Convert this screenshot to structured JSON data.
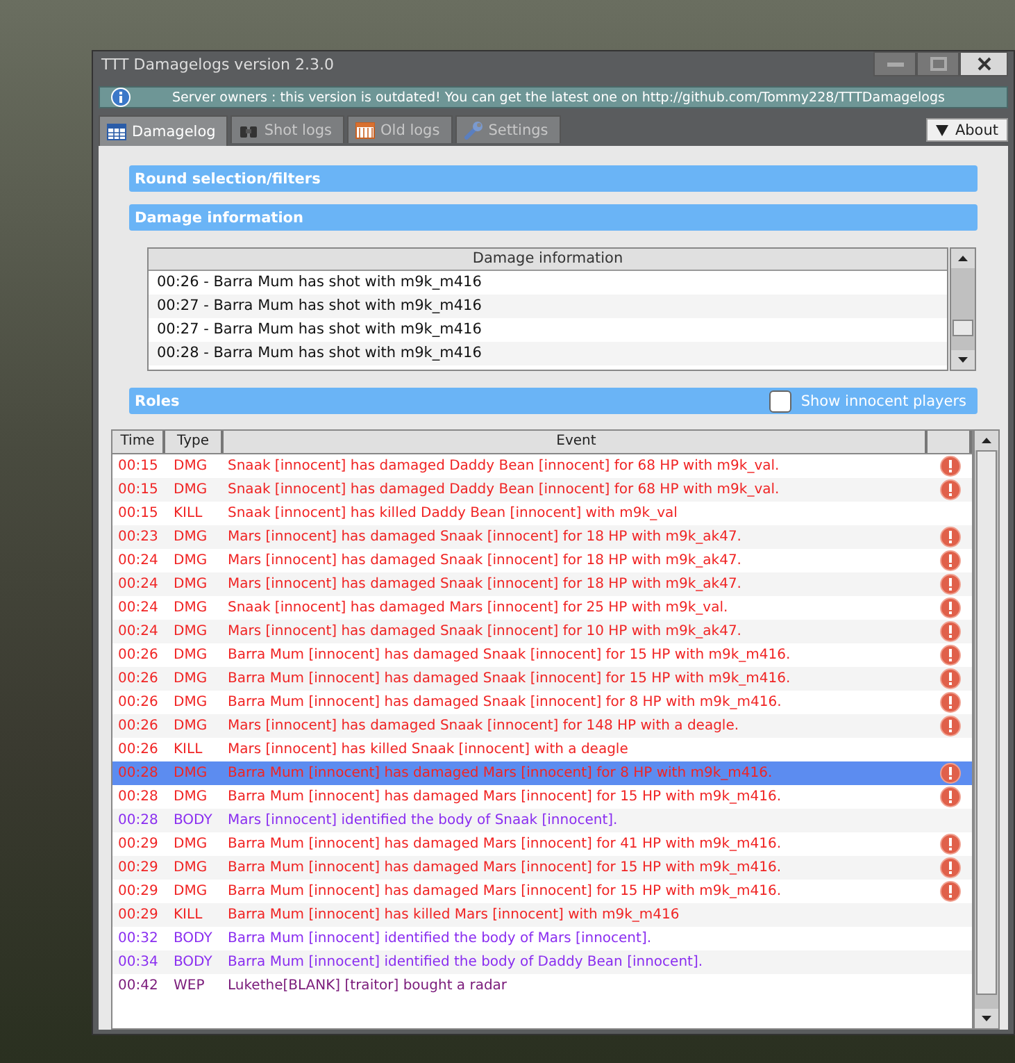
{
  "window": {
    "title": "TTT Damagelogs version 2.3.0"
  },
  "notice": {
    "text": "Server owners : this version is outdated! You can get the latest one on http://github.com/Tommy228/TTTDamagelogs"
  },
  "tabs": [
    {
      "label": "Damagelog",
      "selected": true
    },
    {
      "label": "Shot logs",
      "selected": false
    },
    {
      "label": "Old logs",
      "selected": false
    },
    {
      "label": "Settings",
      "selected": false
    }
  ],
  "about_button": {
    "label": "About"
  },
  "sections": {
    "round_selection": {
      "title": "Round selection/filters"
    },
    "damage_information": {
      "title": "Damage information"
    },
    "roles": {
      "title": "Roles"
    }
  },
  "damage_list": {
    "column": "Damage information",
    "rows": [
      "00:26 - Barra Mum has shot with m9k_m416",
      "00:27 - Barra Mum has shot with m9k_m416",
      "00:27 - Barra Mum has shot with m9k_m416",
      "00:28 - Barra Mum has shot with m9k_m416"
    ]
  },
  "show_innocent": {
    "label": "Show innocent players",
    "checked": false
  },
  "log_table": {
    "columns": [
      "Time",
      "Type",
      "Event"
    ],
    "rows": [
      {
        "time": "00:15",
        "type": "DMG",
        "kind": "dmg",
        "event": "Snaak [innocent] has damaged Daddy Bean [innocent] for 68 HP with m9k_val.",
        "alert": true,
        "selected": false
      },
      {
        "time": "00:15",
        "type": "DMG",
        "kind": "dmg",
        "event": "Snaak [innocent] has damaged Daddy Bean [innocent] for 68 HP with m9k_val.",
        "alert": true,
        "selected": false
      },
      {
        "time": "00:15",
        "type": "KILL",
        "kind": "kill",
        "event": "Snaak [innocent] has killed Daddy Bean [innocent] with m9k_val",
        "alert": false,
        "selected": false
      },
      {
        "time": "00:23",
        "type": "DMG",
        "kind": "dmg",
        "event": "Mars [innocent] has damaged Snaak [innocent] for 18 HP with m9k_ak47.",
        "alert": true,
        "selected": false
      },
      {
        "time": "00:24",
        "type": "DMG",
        "kind": "dmg",
        "event": "Mars [innocent] has damaged Snaak [innocent] for 18 HP with m9k_ak47.",
        "alert": true,
        "selected": false
      },
      {
        "time": "00:24",
        "type": "DMG",
        "kind": "dmg",
        "event": "Mars [innocent] has damaged Snaak [innocent] for 18 HP with m9k_ak47.",
        "alert": true,
        "selected": false
      },
      {
        "time": "00:24",
        "type": "DMG",
        "kind": "dmg",
        "event": "Snaak [innocent] has damaged Mars [innocent] for 25 HP with m9k_val.",
        "alert": true,
        "selected": false
      },
      {
        "time": "00:24",
        "type": "DMG",
        "kind": "dmg",
        "event": "Mars [innocent] has damaged Snaak [innocent] for 10 HP with m9k_ak47.",
        "alert": true,
        "selected": false
      },
      {
        "time": "00:26",
        "type": "DMG",
        "kind": "dmg",
        "event": "Barra Mum [innocent] has damaged Snaak [innocent] for 15 HP with m9k_m416.",
        "alert": true,
        "selected": false
      },
      {
        "time": "00:26",
        "type": "DMG",
        "kind": "dmg",
        "event": "Barra Mum [innocent] has damaged Snaak [innocent] for 15 HP with m9k_m416.",
        "alert": true,
        "selected": false
      },
      {
        "time": "00:26",
        "type": "DMG",
        "kind": "dmg",
        "event": "Barra Mum [innocent] has damaged Snaak [innocent] for 8 HP with m9k_m416.",
        "alert": true,
        "selected": false
      },
      {
        "time": "00:26",
        "type": "DMG",
        "kind": "dmg",
        "event": "Mars [innocent] has damaged Snaak [innocent] for 148 HP with a deagle.",
        "alert": true,
        "selected": false
      },
      {
        "time": "00:26",
        "type": "KILL",
        "kind": "kill",
        "event": "Mars [innocent] has killed Snaak [innocent] with a deagle",
        "alert": false,
        "selected": false
      },
      {
        "time": "00:28",
        "type": "DMG",
        "kind": "dmg",
        "event": "Barra Mum [innocent] has damaged Mars [innocent] for 8 HP with m9k_m416.",
        "alert": true,
        "selected": true
      },
      {
        "time": "00:28",
        "type": "DMG",
        "kind": "dmg",
        "event": "Barra Mum [innocent] has damaged Mars [innocent] for 15 HP with m9k_m416.",
        "alert": true,
        "selected": false
      },
      {
        "time": "00:28",
        "type": "BODY",
        "kind": "body",
        "event": "Mars [innocent] identified the body of Snaak [innocent].",
        "alert": false,
        "selected": false
      },
      {
        "time": "00:29",
        "type": "DMG",
        "kind": "dmg",
        "event": "Barra Mum [innocent] has damaged Mars [innocent] for 41 HP with m9k_m416.",
        "alert": true,
        "selected": false
      },
      {
        "time": "00:29",
        "type": "DMG",
        "kind": "dmg",
        "event": "Barra Mum [innocent] has damaged Mars [innocent] for 15 HP with m9k_m416.",
        "alert": true,
        "selected": false
      },
      {
        "time": "00:29",
        "type": "DMG",
        "kind": "dmg",
        "event": "Barra Mum [innocent] has damaged Mars [innocent] for 15 HP with m9k_m416.",
        "alert": true,
        "selected": false
      },
      {
        "time": "00:29",
        "type": "KILL",
        "kind": "kill",
        "event": "Barra Mum [innocent] has killed Mars [innocent] with m9k_m416",
        "alert": false,
        "selected": false
      },
      {
        "time": "00:32",
        "type": "BODY",
        "kind": "body",
        "event": "Barra Mum [innocent] identified the body of Mars [innocent].",
        "alert": false,
        "selected": false
      },
      {
        "time": "00:34",
        "type": "BODY",
        "kind": "body",
        "event": "Barra Mum [innocent] identified the body of Daddy Bean [innocent].",
        "alert": false,
        "selected": false
      },
      {
        "time": "00:42",
        "type": "WEP",
        "kind": "wep",
        "event": "Lukethe[BLANK] [traitor] bought a radar",
        "alert": false,
        "selected": false
      }
    ]
  }
}
